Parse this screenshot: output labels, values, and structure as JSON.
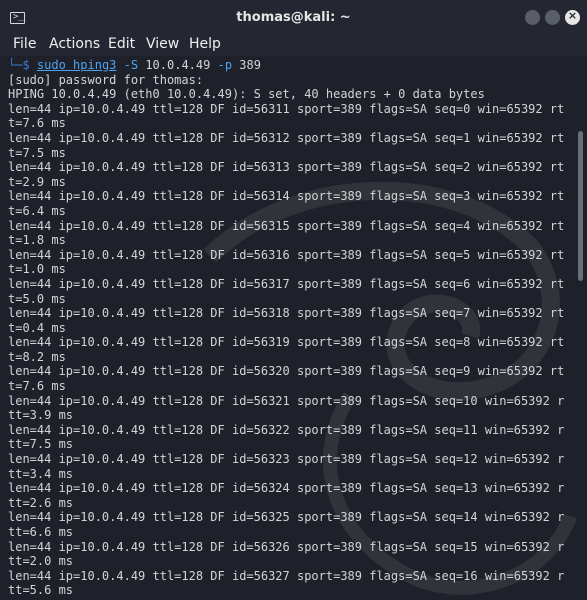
{
  "window": {
    "title": "thomas@kali: ~"
  },
  "menu": [
    "File",
    "Actions",
    "Edit",
    "View",
    "Help"
  ],
  "prompt": {
    "corner": "└─$",
    "cmd": "sudo hping3",
    "flag_s": "-S",
    "ip": "10.0.4.49",
    "flag_p": "-p",
    "port": "389"
  },
  "output": [
    "[sudo] password for thomas:",
    "HPING 10.0.4.49 (eth0 10.0.4.49): S set, 40 headers + 0 data bytes",
    "len=44 ip=10.0.4.49 ttl=128 DF id=56311 sport=389 flags=SA seq=0 win=65392 rt",
    "t=7.6 ms",
    "len=44 ip=10.0.4.49 ttl=128 DF id=56312 sport=389 flags=SA seq=1 win=65392 rt",
    "t=7.5 ms",
    "len=44 ip=10.0.4.49 ttl=128 DF id=56313 sport=389 flags=SA seq=2 win=65392 rt",
    "t=2.9 ms",
    "len=44 ip=10.0.4.49 ttl=128 DF id=56314 sport=389 flags=SA seq=3 win=65392 rt",
    "t=6.4 ms",
    "len=44 ip=10.0.4.49 ttl=128 DF id=56315 sport=389 flags=SA seq=4 win=65392 rt",
    "t=1.8 ms",
    "len=44 ip=10.0.4.49 ttl=128 DF id=56316 sport=389 flags=SA seq=5 win=65392 rt",
    "t=1.0 ms",
    "len=44 ip=10.0.4.49 ttl=128 DF id=56317 sport=389 flags=SA seq=6 win=65392 rt",
    "t=5.0 ms",
    "len=44 ip=10.0.4.49 ttl=128 DF id=56318 sport=389 flags=SA seq=7 win=65392 rt",
    "t=0.4 ms",
    "len=44 ip=10.0.4.49 ttl=128 DF id=56319 sport=389 flags=SA seq=8 win=65392 rt",
    "t=8.2 ms",
    "len=44 ip=10.0.4.49 ttl=128 DF id=56320 sport=389 flags=SA seq=9 win=65392 rt",
    "t=7.6 ms",
    "len=44 ip=10.0.4.49 ttl=128 DF id=56321 sport=389 flags=SA seq=10 win=65392 r",
    "tt=3.9 ms",
    "len=44 ip=10.0.4.49 ttl=128 DF id=56322 sport=389 flags=SA seq=11 win=65392 r",
    "tt=7.5 ms",
    "len=44 ip=10.0.4.49 ttl=128 DF id=56323 sport=389 flags=SA seq=12 win=65392 r",
    "tt=3.4 ms",
    "len=44 ip=10.0.4.49 ttl=128 DF id=56324 sport=389 flags=SA seq=13 win=65392 r",
    "tt=2.6 ms",
    "len=44 ip=10.0.4.49 ttl=128 DF id=56325 sport=389 flags=SA seq=14 win=65392 r",
    "tt=6.6 ms",
    "len=44 ip=10.0.4.49 ttl=128 DF id=56326 sport=389 flags=SA seq=15 win=65392 r",
    "tt=2.0 ms",
    "len=44 ip=10.0.4.49 ttl=128 DF id=56327 sport=389 flags=SA seq=16 win=65392 r",
    "tt=5.6 ms"
  ],
  "colors": {
    "background": "#1e2129",
    "titlebar": "#242731",
    "text": "#d4d4d4",
    "command": "#4ea3f0"
  },
  "icons": {
    "window": "terminal-icon",
    "close": "close-icon"
  }
}
